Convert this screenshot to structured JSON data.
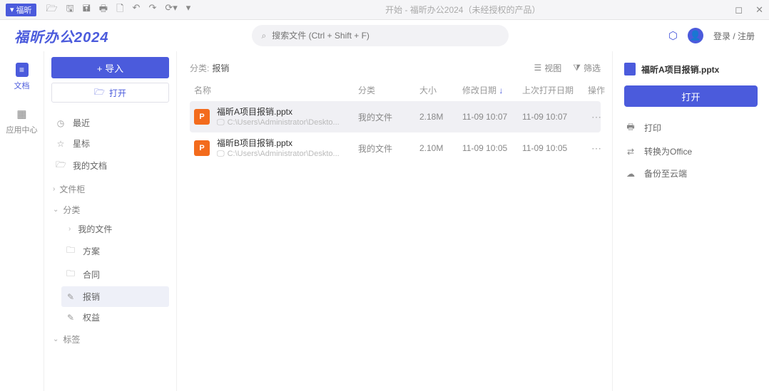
{
  "titlebar": {
    "badge": "福昕",
    "title": "开始 - 福昕办公2024（未经授权的产品）"
  },
  "brand": "福昕办公2024",
  "search": {
    "placeholder": "搜索文件 (Ctrl + Shift + F)"
  },
  "account": {
    "login": "登录 / 注册"
  },
  "rail": {
    "docs": "文档",
    "apps": "应用中心"
  },
  "sidebar": {
    "import": "+ 导入",
    "open": "打开",
    "nav": {
      "recent": "最近",
      "star": "星标",
      "mine": "我的文档"
    },
    "sec_filebox": "文件柜",
    "sec_category": "分类",
    "cats": {
      "mine": "我的文件",
      "plan": "方案",
      "contract": "合同",
      "report": "报销",
      "auth": "权益"
    },
    "sec_tags": "标签"
  },
  "content": {
    "crumb_label": "分类:",
    "crumb_value": "报销",
    "view": "视图",
    "filter": "筛选",
    "headers": {
      "name": "名称",
      "cat": "分类",
      "size": "大小",
      "mod": "修改日期",
      "open": "上次打开日期",
      "op": "操作"
    },
    "rows": [
      {
        "name": "福昕A项目报销.pptx",
        "path": "C:\\Users\\Administrator\\Deskto...",
        "cat": "我的文件",
        "size": "2.18M",
        "mod": "11-09 10:07",
        "open": "11-09 10:07"
      },
      {
        "name": "福昕B项目报销.pptx",
        "path": "C:\\Users\\Administrator\\Deskto...",
        "cat": "我的文件",
        "size": "2.10M",
        "mod": "11-09 10:05",
        "open": "11-09 10:05"
      }
    ]
  },
  "detail": {
    "title": "福昕A项目报销.pptx",
    "open": "打开",
    "actions": {
      "print": "打印",
      "convert": "转换为Office",
      "backup": "备份至云端"
    }
  }
}
